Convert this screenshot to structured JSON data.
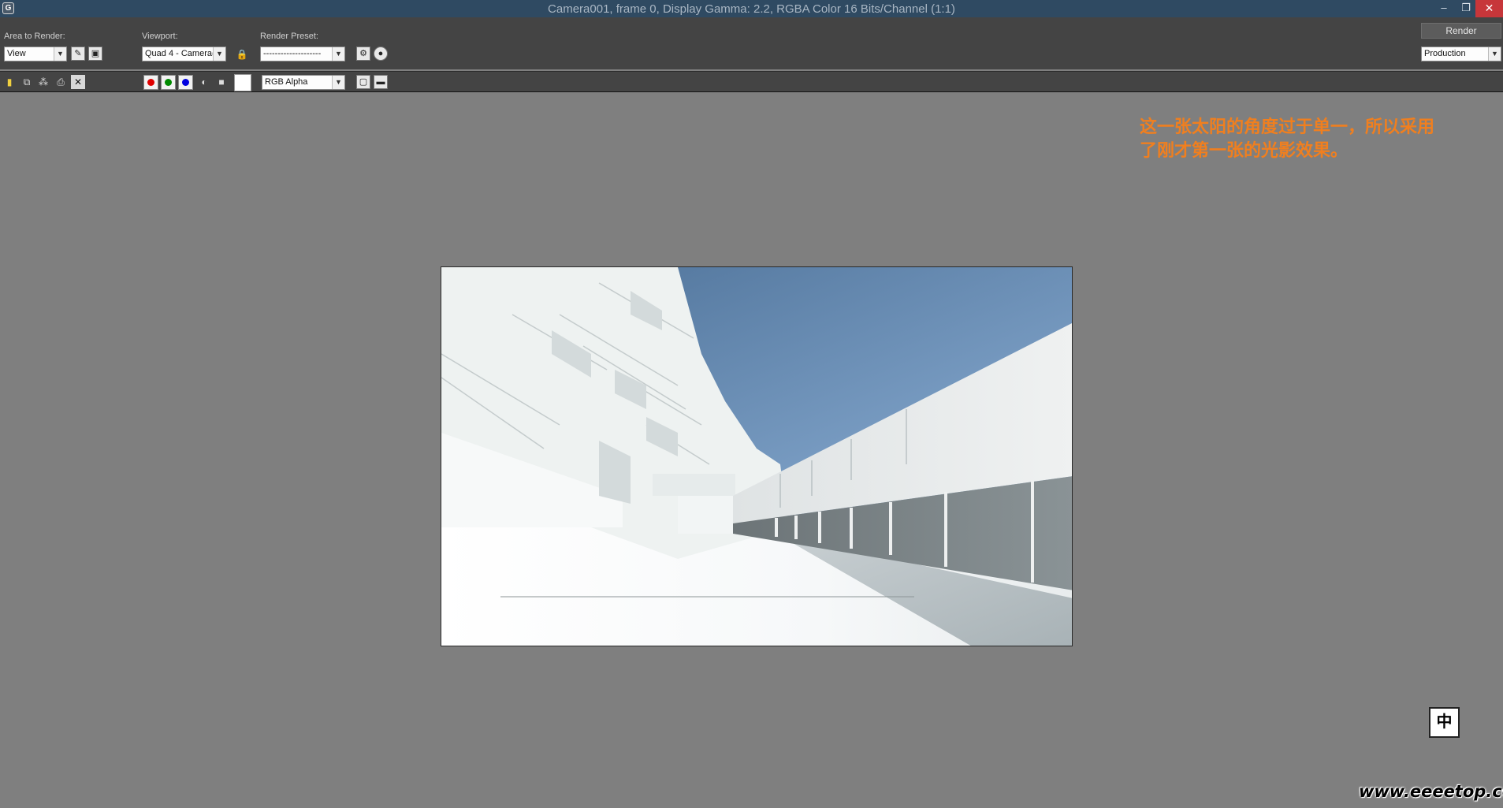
{
  "window": {
    "title": "Camera001, frame 0, Display Gamma: 2.2, RGBA Color 16 Bits/Channel (1:1)",
    "app_icon": "G",
    "minimize": "–",
    "maximize": "❐",
    "close": "✕"
  },
  "toolbar": {
    "area_to_render_label": "Area to Render:",
    "area_to_render_value": "View",
    "viewport_label": "Viewport:",
    "viewport_value": "Quad 4 - Camera(",
    "render_preset_label": "Render Preset:",
    "render_preset_value": "--------------------",
    "render_button": "Render",
    "production_value": "Production"
  },
  "toolbar2": {
    "channel_value": "RGB Alpha"
  },
  "colors": {
    "red_channel": "#e00000",
    "green_channel": "#008a00",
    "blue_channel": "#0000e0",
    "annotation": "#f07f1f",
    "titlebar": "#2f4a62"
  },
  "icons": [
    "save-icon",
    "copy-icon",
    "clone-icon",
    "print-icon",
    "clear-icon",
    "crop-icon",
    "region-icon",
    "lock-icon",
    "render-setup-icon",
    "environment-icon",
    "alpha-icon",
    "mono-icon",
    "toggle-ui-icon",
    "display-icon"
  ],
  "annotation": {
    "line1": "这一张太阳的角度过于单一，所以采用",
    "line2": "了刚才第一张的光影效果。"
  },
  "ime": {
    "label": "中"
  },
  "watermark": {
    "text": "www.eeeetop.com"
  }
}
